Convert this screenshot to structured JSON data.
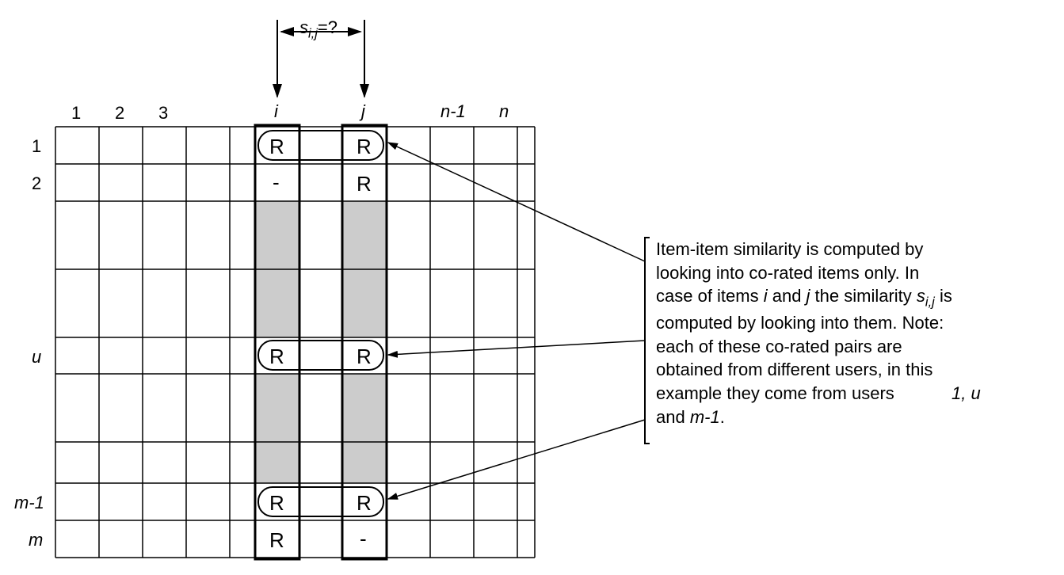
{
  "similarity_label_prefix": "s",
  "similarity_label_sub": "i,j",
  "similarity_label_suffix": "=?",
  "col_labels": {
    "c1": "1",
    "c2": "2",
    "c3": "3",
    "ci": "i",
    "cj": "j",
    "cn1": "n-1",
    "cn": "n"
  },
  "row_labels": {
    "r1": "1",
    "r2": "2",
    "ru": "u",
    "rm1": "m-1",
    "rm": "m"
  },
  "cells": {
    "r1_i": "R",
    "r1_j": "R",
    "r2_i": "-",
    "r2_j": "R",
    "ru_i": "R",
    "ru_j": "R",
    "rm1_i": "R",
    "rm1_j": "R",
    "rm_i": "R",
    "rm_j": "-"
  },
  "annotation": {
    "line1": "Item-item similarity is computed by",
    "line2": "looking into co-rated items only. In",
    "line3a": "case of items  ",
    "line3_i": "i",
    "line3b": " and ",
    "line3_j": "j",
    "line3c": " the similarity  ",
    "line3_s": "s",
    "line3_sub": "i,j",
    "line3d": " is",
    "line4": "computed by looking into them. Note:",
    "line5": "each of these co-rated pairs are",
    "line6": "obtained from different users, in this",
    "line7a": "example they come from users",
    "line7_extra": "1, u",
    "line8a": "and ",
    "line8_m1": "m-1",
    "line8b": "."
  }
}
